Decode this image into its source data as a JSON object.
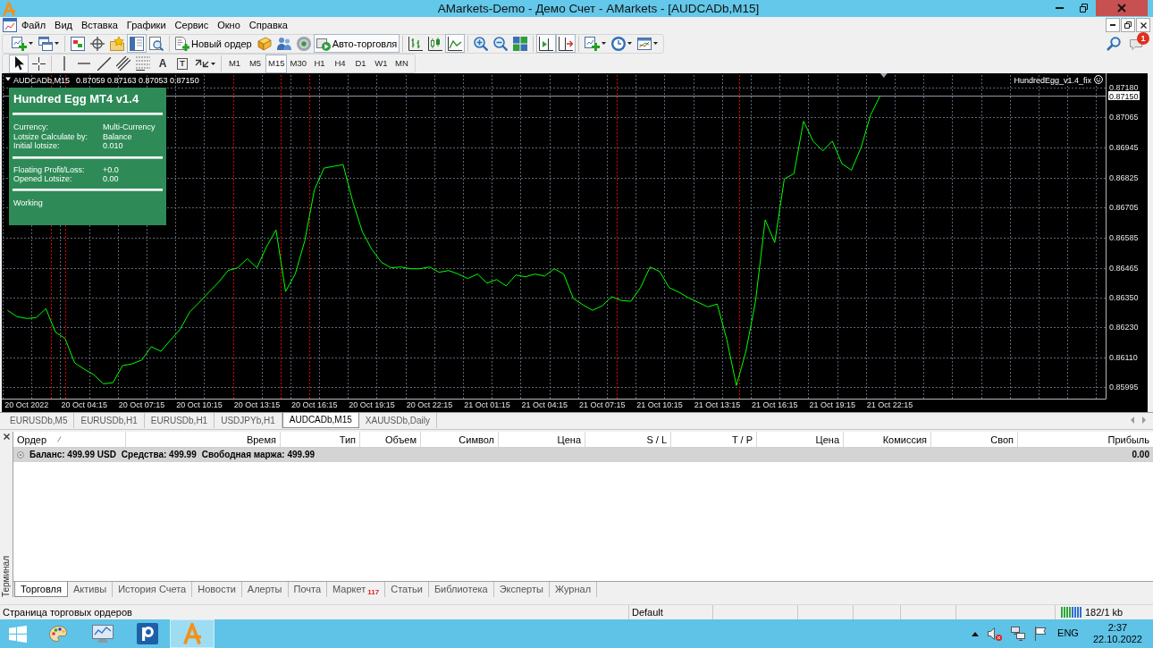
{
  "window": {
    "title": "AMarkets-Demo - Демо Счет - AMarkets - [AUDCADb,M15]"
  },
  "menu": [
    "Файл",
    "Вид",
    "Вставка",
    "Графики",
    "Сервис",
    "Окно",
    "Справка"
  ],
  "toolbar": [
    [
      {
        "kind": "icon",
        "pressed": false
      },
      {
        "kind": "icon",
        "pressed": false
      }
    ],
    [
      {
        "kind": "icon",
        "pressed": false
      },
      {
        "kind": "icon",
        "pressed": false
      },
      {
        "kind": "icon",
        "pressed": false
      },
      {
        "kind": "icon",
        "pressed": true
      },
      {
        "kind": "icon",
        "pressed": false
      }
    ],
    [
      {
        "kind": "labeled",
        "label": "Новый ордер",
        "pressed": false
      },
      {
        "kind": "icon",
        "pressed": false
      },
      {
        "kind": "icon",
        "pressed": false
      },
      {
        "kind": "icon",
        "pressed": false
      },
      {
        "kind": "labeled",
        "label": "Авто-торговля",
        "pressed": true
      }
    ],
    [
      {
        "kind": "icon",
        "pressed": false
      },
      {
        "kind": "icon",
        "pressed": false
      },
      {
        "kind": "icon",
        "pressed": true
      }
    ],
    [
      {
        "kind": "icon",
        "pressed": false
      },
      {
        "kind": "icon",
        "pressed": false
      },
      {
        "kind": "icon",
        "pressed": false
      }
    ],
    [
      {
        "kind": "icon",
        "pressed": true
      },
      {
        "kind": "icon",
        "pressed": true
      }
    ],
    [
      {
        "kind": "icon",
        "pressed": false
      },
      {
        "kind": "icon",
        "pressed": false
      },
      {
        "kind": "icon",
        "pressed": false
      }
    ]
  ],
  "notifications": {
    "count": "1"
  },
  "drawing_tools": [
    [
      {
        "kind": "icon",
        "pressed": true
      },
      {
        "kind": "icon",
        "pressed": false
      }
    ],
    [
      {
        "kind": "icon",
        "pressed": false
      },
      {
        "kind": "icon",
        "pressed": false
      },
      {
        "kind": "icon",
        "pressed": false
      },
      {
        "kind": "icon",
        "pressed": false
      },
      {
        "kind": "icon",
        "pressed": false
      },
      {
        "kind": "glyph",
        "label": "A",
        "pressed": false
      },
      {
        "kind": "boxed",
        "label": "T",
        "pressed": false
      },
      {
        "kind": "icon",
        "pressed": false
      }
    ]
  ],
  "timeframes": [
    {
      "label": "M1",
      "selected": false
    },
    {
      "label": "M5",
      "selected": false
    },
    {
      "label": "M15",
      "selected": true
    },
    {
      "label": "M30",
      "selected": false
    },
    {
      "label": "H1",
      "selected": false
    },
    {
      "label": "H4",
      "selected": false
    },
    {
      "label": "D1",
      "selected": false
    },
    {
      "label": "W1",
      "selected": false
    },
    {
      "label": "MN",
      "selected": false
    }
  ],
  "chart": {
    "symbol": "AUDCADb,M15",
    "ohlc": "0.87059 0.87163 0.87053 0.87150",
    "expert": "HundredEgg_v1.4_fix",
    "chart_data": {
      "type": "line",
      "categories": [
        null,
        null,
        "20 Oct 2022",
        null,
        null,
        null,
        null,
        null,
        "20 Oct 04:15",
        null,
        null,
        null,
        null,
        null,
        "20 Oct 07:15",
        null,
        null,
        null,
        null,
        null,
        "20 Oct 10:15",
        null,
        null,
        null,
        null,
        null,
        "20 Oct 13:15",
        null,
        null,
        null,
        null,
        null,
        "20 Oct 16:15",
        null,
        null,
        null,
        null,
        null,
        "20 Oct 19:15",
        null,
        null,
        null,
        null,
        null,
        "20 Oct 22:15",
        null,
        null,
        null,
        null,
        null,
        "21 Oct 01:15",
        null,
        null,
        null,
        null,
        null,
        "21 Oct 04:15",
        null,
        null,
        null,
        null,
        null,
        "21 Oct 07:15",
        null,
        null,
        null,
        null,
        null,
        "21 Oct 10:15",
        null,
        null,
        null,
        null,
        null,
        "21 Oct 13:15",
        null,
        null,
        null,
        null,
        null,
        "21 Oct 16:15",
        null,
        null,
        null,
        null,
        null,
        "21 Oct 19:15",
        null,
        null,
        null,
        null,
        null,
        "21 Oct 22:15",
        null,
        null,
        null,
        null,
        null,
        null,
        null,
        null,
        null,
        null,
        null,
        null,
        null,
        null,
        null,
        null,
        null,
        null,
        null,
        null,
        null,
        null
      ],
      "series": [
        {
          "color": "#00ff00",
          "values": [
            0.86298,
            0.86273,
            0.86266,
            0.86269,
            0.86305,
            0.86212,
            0.86187,
            0.8609,
            0.86065,
            0.86043,
            0.86007,
            0.86011,
            0.86079,
            0.86086,
            0.86101,
            0.86154,
            0.86136,
            0.8618,
            0.86223,
            0.86291,
            0.8633,
            0.8637,
            0.86409,
            0.86456,
            0.86467,
            0.86503,
            0.86467,
            0.86549,
            0.86617,
            0.86373,
            0.86442,
            0.86574,
            0.86775,
            0.86862,
            0.86869,
            0.86876,
            0.86729,
            0.8661,
            0.86539,
            0.86488,
            0.86467,
            0.8647,
            0.86463,
            0.86463,
            0.8647,
            0.86449,
            0.86456,
            0.86442,
            0.86424,
            0.86442,
            0.86406,
            0.8642,
            0.86395,
            0.86438,
            0.86431,
            0.86442,
            0.86434,
            0.86463,
            0.86442,
            0.86345,
            0.8632,
            0.86298,
            0.86316,
            0.86352,
            0.86337,
            0.86334,
            0.86388,
            0.8647,
            0.86452,
            0.86388,
            0.8637,
            0.86348,
            0.8633,
            0.86312,
            0.86323,
            0.86183,
            0.86,
            0.86136,
            0.86334,
            0.86657,
            0.86567,
            0.86819,
            0.8684,
            0.87048,
            0.86969,
            0.8693,
            0.86969,
            0.8688,
            0.86854,
            0.86944,
            0.87073,
            0.8715,
            null,
            null,
            null,
            null,
            null,
            null,
            null,
            null,
            null,
            null,
            null,
            null,
            null,
            null,
            null,
            null,
            null,
            null,
            null,
            null,
            null,
            null,
            null
          ]
        }
      ],
      "ylim": [
        0.85948,
        0.87231
      ],
      "yticks": [
        {
          "value": 0.85995,
          "label": "0.85995"
        },
        {
          "value": 0.8611,
          "label": "0.86110"
        },
        {
          "value": 0.8623,
          "label": "0.86230"
        },
        {
          "value": 0.8635,
          "label": "0.86350"
        },
        {
          "value": 0.86465,
          "label": "0.86465"
        },
        {
          "value": 0.86585,
          "label": "0.86585"
        },
        {
          "value": 0.86705,
          "label": "0.86705"
        },
        {
          "value": 0.86825,
          "label": "0.86825"
        },
        {
          "value": 0.86945,
          "label": "0.86945"
        },
        {
          "value": 0.87065,
          "label": "0.87065"
        },
        {
          "value": 0.8718,
          "label": "0.87180"
        }
      ],
      "grid": true,
      "ref_lines": [
        {
          "axis": "y",
          "value": 0.8715,
          "label": "0.87150"
        }
      ]
    }
  },
  "expert_panel": {
    "title": "Hundred Egg MT4 v1.4",
    "sections": [
      [
        {
          "label": "Currency:",
          "value": "Multi-Currency"
        },
        {
          "label": "Lotsize Calculate by:",
          "value": "Balance"
        },
        {
          "label": "Initial lotsize:",
          "value": "0.010"
        }
      ],
      [
        {
          "label": "Floating Profit/Loss:",
          "value": "+0.0"
        },
        {
          "label": "Opened Lotsize:",
          "value": "0.00"
        }
      ]
    ],
    "status": "Working"
  },
  "chart_tabs": [
    {
      "label": "EURUSDb,M5",
      "selected": false
    },
    {
      "label": "EURUSDb,H1",
      "selected": false
    },
    {
      "label": "EURUSDb,H1",
      "selected": false
    },
    {
      "label": "USDJPYb,H1",
      "selected": false
    },
    {
      "label": "AUDCADb,M15",
      "selected": true
    },
    {
      "label": "XAUUSDb,Daily",
      "selected": false
    }
  ],
  "terminal": {
    "label": "Терминал",
    "columns": [
      {
        "label": "Ордер",
        "sorted": true
      },
      {
        "label": "Время",
        "sorted": false
      },
      {
        "label": "Тип",
        "sorted": false
      },
      {
        "label": "Объем",
        "sorted": false
      },
      {
        "label": "Символ",
        "sorted": false
      },
      {
        "label": "Цена",
        "sorted": false
      },
      {
        "label": "S / L",
        "sorted": false
      },
      {
        "label": "T / P",
        "sorted": false
      },
      {
        "label": "Цена",
        "sorted": false
      },
      {
        "label": "Комиссия",
        "sorted": false
      },
      {
        "label": "Своп",
        "sorted": false
      },
      {
        "label": "Прибыль",
        "sorted": false
      }
    ],
    "summary": [
      "Баланс: 499.99 USD",
      "Средства: 499.99",
      "Свободная маржа: 499.99"
    ],
    "profit": "0.00",
    "tabs": [
      {
        "label": "Торговля",
        "selected": true
      },
      {
        "label": "Активы",
        "selected": false
      },
      {
        "label": "История Счета",
        "selected": false
      },
      {
        "label": "Новости",
        "selected": false
      },
      {
        "label": "Алерты",
        "selected": false
      },
      {
        "label": "Почта",
        "selected": false
      },
      {
        "label": "Маркет",
        "badge": "117",
        "selected": false
      },
      {
        "label": "Статьи",
        "selected": false
      },
      {
        "label": "Библиотека",
        "selected": false
      },
      {
        "label": "Эксперты",
        "selected": false
      },
      {
        "label": "Журнал",
        "selected": false
      }
    ]
  },
  "status_bar": {
    "text": "Страница торговых ордеров",
    "profile": "Default",
    "traffic": "182/1 kb"
  },
  "taskbar": {
    "apps": [
      {
        "selected": false
      },
      {
        "selected": false
      },
      {
        "selected": false
      },
      {
        "selected": true
      }
    ],
    "language": "ENG",
    "time": "2:37",
    "date": "22.10.2022"
  }
}
